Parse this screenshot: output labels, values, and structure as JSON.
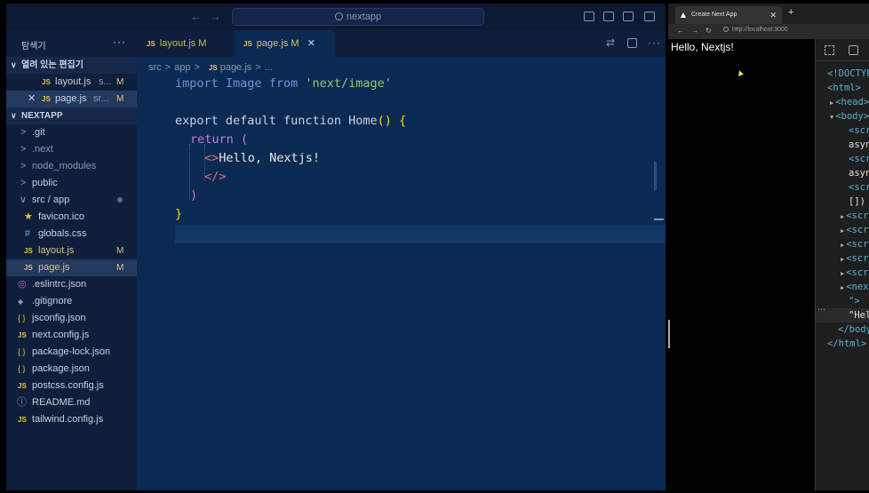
{
  "titlebar": {
    "search_text": "nextapp"
  },
  "sidebar": {
    "title": "탐색기",
    "more": "···",
    "open_editors": {
      "header": "열려 있는 편집기",
      "items": [
        {
          "icon": "JS",
          "label": "layout.js",
          "detail": "s...",
          "badge": "M"
        },
        {
          "icon": "JS",
          "label": "page.js",
          "detail": "sr...",
          "badge": "M",
          "close": "✕"
        }
      ]
    },
    "project": {
      "header": "NEXTAPP",
      "items": [
        {
          "label": ".git"
        },
        {
          "label": ".next"
        },
        {
          "label": "node_modules"
        },
        {
          "label": "public"
        },
        {
          "label": "src / app"
        },
        {
          "icon": "★",
          "label": "favicon.ico"
        },
        {
          "icon": "#",
          "label": "globals.css"
        },
        {
          "icon": "JS",
          "label": "layout.js",
          "badge": "M"
        },
        {
          "icon": "JS",
          "label": "page.js",
          "badge": "M"
        },
        {
          "icon": "◎",
          "label": ".eslintrc.json"
        },
        {
          "icon": "◆",
          "label": ".gitignore"
        },
        {
          "icon": "{ }",
          "label": "jsconfig.json"
        },
        {
          "icon": "JS",
          "label": "next.config.js"
        },
        {
          "icon": "{ }",
          "label": "package-lock.json"
        },
        {
          "icon": "{ }",
          "label": "package.json"
        },
        {
          "icon": "JS",
          "label": "postcss.config.js"
        },
        {
          "icon": "ⓘ",
          "label": "README.md"
        },
        {
          "icon": "JS",
          "label": "tailwind.config.js"
        }
      ]
    }
  },
  "editor": {
    "tabs": [
      {
        "icon": "JS",
        "label": "layout.js",
        "badge": "M"
      },
      {
        "icon": "JS",
        "label": "page.js",
        "badge": "M",
        "close": "✕"
      }
    ],
    "breadcrumb": {
      "part1": "src",
      "part2": "app",
      "icon": "JS",
      "part3": "page.js",
      "part4": "..."
    },
    "code": {
      "import_kw": "import",
      "import_id": "Image",
      "from_kw": "from",
      "import_str": "'next/image'",
      "export_kw": "export",
      "default_kw": "default",
      "function_kw": "function",
      "fn_name": "Home",
      "parens": "()",
      "brace_open": "{",
      "return_kw": "return",
      "paren_open": "(",
      "frag_open": "<>",
      "jsx_text": "Hello, Nextjs!",
      "frag_close": "</>",
      "paren_close": ")",
      "brace_close": "}"
    }
  },
  "browser": {
    "tab_title": "Create Next App",
    "tab_close": "✕",
    "new_tab": "+",
    "url": "http://localhost:3000",
    "page_heading": "Hello, Nextjs!",
    "devtools": {
      "dom": [
        {
          "indent": 0,
          "text": "<!DOCTYPE html>",
          "kind": "tag"
        },
        {
          "indent": 0,
          "text": "<html>",
          "kind": "tag"
        },
        {
          "indent": 1,
          "text": "<head>",
          "kind": "tag",
          "tri": "▶"
        },
        {
          "indent": 1,
          "text": "<body>",
          "kind": "tag",
          "tri": "▼"
        },
        {
          "indent": 2,
          "text": "<script",
          "kind": "tag"
        },
        {
          "indent": 2,
          "text": "async",
          "kind": "text"
        },
        {
          "indent": 2,
          "text": "<script",
          "kind": "tag"
        },
        {
          "indent": 2,
          "text": "async",
          "kind": "text"
        },
        {
          "indent": 2,
          "text": "<script",
          "kind": "tag"
        },
        {
          "indent": 2,
          "text": "[])",
          "kind": "text"
        },
        {
          "indent": 2,
          "text": "<script",
          "kind": "tag",
          "tri": "▶"
        },
        {
          "indent": 2,
          "text": "<script",
          "kind": "tag",
          "tri": "▶"
        },
        {
          "indent": 2,
          "text": "<script",
          "kind": "tag",
          "tri": "▶"
        },
        {
          "indent": 2,
          "text": "<script",
          "kind": "tag",
          "tri": "▶"
        },
        {
          "indent": 2,
          "text": "<script",
          "kind": "tag",
          "tri": "▶"
        },
        {
          "indent": 2,
          "text": "<next-route-announcer",
          "kind": "tag",
          "tri": "▶"
        },
        {
          "indent": 2,
          "text": "\">",
          "kind": "tag"
        },
        {
          "indent": 2,
          "text": "\"Hello, Nextjs!\"",
          "kind": "text",
          "selected": true
        },
        {
          "indent": 1,
          "text": "</body>",
          "kind": "tag"
        },
        {
          "indent": 0,
          "text": "</html>",
          "kind": "tag"
        }
      ],
      "ellipsis": "···"
    }
  }
}
